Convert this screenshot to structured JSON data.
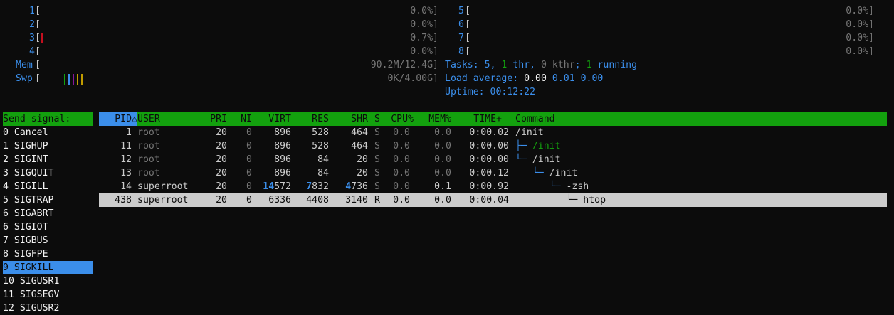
{
  "meters": {
    "cpus_left": [
      {
        "label": "1",
        "value": "0.0%]"
      },
      {
        "label": "2",
        "value": "0.0%]"
      },
      {
        "label": "3",
        "value": "0.7%]"
      },
      {
        "label": "4",
        "value": "0.0%]"
      }
    ],
    "cpus_right": [
      {
        "label": "5",
        "value": "0.0%]"
      },
      {
        "label": "6",
        "value": "0.0%]"
      },
      {
        "label": "7",
        "value": "0.0%]"
      },
      {
        "label": "8",
        "value": "0.0%]"
      }
    ],
    "cpu3_level_percent": 0.7,
    "mem": {
      "label": "Mem",
      "value": "90.2M/12.4G]"
    },
    "swp": {
      "label": "Swp",
      "value": "0K/4.00G]"
    },
    "bracket_open": "["
  },
  "tasks": {
    "label": "Tasks: ",
    "count": "5",
    "sep1": ", ",
    "thr": "1",
    "thr_label": " thr",
    "sep2": ", ",
    "kthr": "0 kthr",
    "sep3": "; ",
    "running": "1",
    "running_label": " running"
  },
  "load": {
    "label": "Load average: ",
    "one": "0.00",
    "five": "0.01",
    "fifteen": "0.00"
  },
  "uptime": {
    "label": "Uptime: ",
    "value": "00:12:22"
  },
  "signals": {
    "header": "Send signal:",
    "items": [
      " 0 Cancel",
      " 1 SIGHUP",
      " 2 SIGINT",
      " 3 SIGQUIT",
      " 4 SIGILL",
      " 5 SIGTRAP",
      " 6 SIGABRT",
      " 6 SIGIOT",
      " 7 SIGBUS",
      " 8 SIGFPE",
      " 9 SIGKILL",
      "10 SIGUSR1",
      "11 SIGSEGV",
      "12 SIGUSR2"
    ],
    "selected_index": 10
  },
  "table": {
    "columns": {
      "pid": "PID△",
      "user": "USER",
      "pri": "PRI",
      "ni": "NI",
      "virt": "VIRT",
      "res": "RES",
      "shr": "SHR",
      "s": "S",
      "cpu": "CPU%",
      "mem": "MEM%",
      "time": "TIME+",
      "command": "Command"
    },
    "rows": [
      {
        "pid": "1",
        "user": "root",
        "pri": "20",
        "ni": "0",
        "virt_hi": "",
        "virt": "896",
        "res_hi": "",
        "res": "528",
        "shr_hi": "",
        "shr": "464",
        "s": "S",
        "cpu": "0.0",
        "mem": "0.0",
        "time": "0:00.02",
        "tree": "",
        "cmd": "/init"
      },
      {
        "pid": "11",
        "user": "root",
        "pri": "20",
        "ni": "0",
        "virt_hi": "",
        "virt": "896",
        "res_hi": "",
        "res": "528",
        "shr_hi": "",
        "shr": "464",
        "s": "S",
        "cpu": "0.0",
        "mem": "0.0",
        "time": "0:00.00",
        "tree": "├─ ",
        "cmd": "/init"
      },
      {
        "pid": "12",
        "user": "root",
        "pri": "20",
        "ni": "0",
        "virt_hi": "",
        "virt": "896",
        "res_hi": "",
        "res": "84",
        "shr_hi": "",
        "shr": "20",
        "s": "S",
        "cpu": "0.0",
        "mem": "0.0",
        "time": "0:00.00",
        "tree": "└─ ",
        "cmd": "/init"
      },
      {
        "pid": "13",
        "user": "root",
        "pri": "20",
        "ni": "0",
        "virt_hi": "",
        "virt": "896",
        "res_hi": "",
        "res": "84",
        "shr_hi": "",
        "shr": "20",
        "s": "S",
        "cpu": "0.0",
        "mem": "0.0",
        "time": "0:00.12",
        "tree": "   └─ ",
        "cmd": "/init"
      },
      {
        "pid": "14",
        "user": "superroot",
        "pri": "20",
        "ni": "0",
        "virt_hi": "14",
        "virt": "572",
        "res_hi": "7",
        "res": "832",
        "shr_hi": "4",
        "shr": "736",
        "s": "S",
        "cpu": "0.0",
        "mem": "0.1",
        "time": "0:00.92",
        "tree": "      └─ ",
        "cmd": "-zsh"
      },
      {
        "pid": "438",
        "user": "superroot",
        "pri": "20",
        "ni": "0",
        "virt_hi": "",
        "virt": "6336",
        "res_hi": "",
        "res": "4408",
        "shr_hi": "",
        "shr": "3140",
        "s": "R",
        "cpu": "0.0",
        "mem": "0.0",
        "time": "0:00.04",
        "tree": "         └─ ",
        "cmd": "htop"
      }
    ],
    "selected_index": 5
  },
  "colors": {
    "background": "#0c0c0c",
    "header_green": "#13a10e",
    "accent_blue": "#3b8eea",
    "selected_row": "#cccccc"
  }
}
